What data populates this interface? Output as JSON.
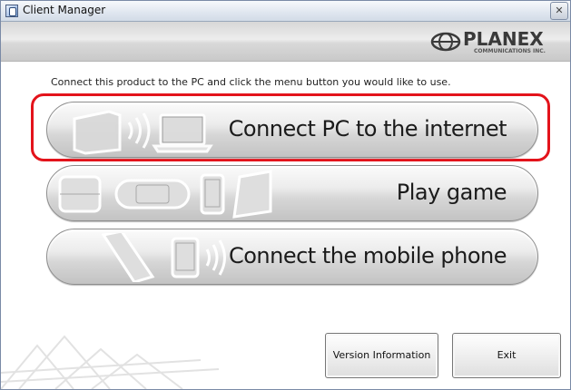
{
  "window": {
    "title": "Client Manager",
    "close_glyph": "✕"
  },
  "banner": {
    "brand_name": "PLANEX",
    "brand_subtitle": "COMMUNICATIONS INC."
  },
  "instruction": "Connect this product to the PC and click the menu button you would like to use.",
  "menu": [
    {
      "label": "Connect PC to the internet",
      "icon": "pc-wireless-icon",
      "highlighted": true
    },
    {
      "label": "Play game",
      "icon": "game-consoles-icon",
      "highlighted": false
    },
    {
      "label": "Connect the mobile phone",
      "icon": "mobile-phone-icon",
      "highlighted": false
    }
  ],
  "buttons": {
    "version": "Version Information",
    "exit": "Exit"
  },
  "colors": {
    "highlight": "#e3131b",
    "button_text": "#1b1b1b"
  }
}
